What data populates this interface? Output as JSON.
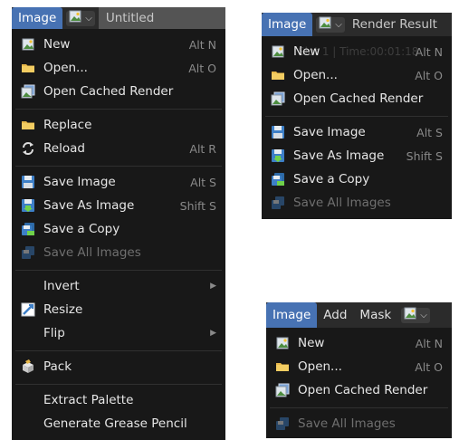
{
  "panel1": {
    "header": {
      "tab": "Image",
      "title": "Untitled"
    },
    "items": [
      {
        "label": "New",
        "shortcut": "Alt N",
        "icon": "image-new-icon"
      },
      {
        "label": "Open...",
        "shortcut": "Alt O",
        "icon": "folder-icon"
      },
      {
        "label": "Open Cached Render",
        "shortcut": "",
        "icon": "cached-render-icon"
      },
      {
        "label": "Replace",
        "shortcut": "",
        "icon": "folder-icon"
      },
      {
        "label": "Reload",
        "shortcut": "Alt R",
        "icon": "reload-icon"
      },
      {
        "label": "Save Image",
        "shortcut": "Alt S",
        "icon": "save-icon"
      },
      {
        "label": "Save As Image",
        "shortcut": "Shift S",
        "icon": "save-as-icon"
      },
      {
        "label": "Save a Copy",
        "shortcut": "",
        "icon": "save-copy-icon"
      },
      {
        "label": "Save All Images",
        "shortcut": "",
        "icon": "save-all-icon"
      },
      {
        "label": "Invert",
        "shortcut": "",
        "icon": ""
      },
      {
        "label": "Resize",
        "shortcut": "",
        "icon": "resize-icon"
      },
      {
        "label": "Flip",
        "shortcut": "",
        "icon": ""
      },
      {
        "label": "Pack",
        "shortcut": "",
        "icon": "pack-icon"
      },
      {
        "label": "Extract Palette",
        "shortcut": "",
        "icon": ""
      },
      {
        "label": "Generate Grease Pencil",
        "shortcut": "",
        "icon": ""
      }
    ]
  },
  "panel2": {
    "header": {
      "tab": "Image",
      "title": "Render Result"
    },
    "ghost_text": "Slot 1 | Time:00:01:18",
    "items": [
      {
        "label": "New",
        "shortcut": "Alt N",
        "icon": "image-new-icon"
      },
      {
        "label": "Open...",
        "shortcut": "Alt O",
        "icon": "folder-icon"
      },
      {
        "label": "Open Cached Render",
        "shortcut": "",
        "icon": "cached-render-icon"
      },
      {
        "label": "Save Image",
        "shortcut": "Alt S",
        "icon": "save-icon"
      },
      {
        "label": "Save As Image",
        "shortcut": "Shift S",
        "icon": "save-as-icon"
      },
      {
        "label": "Save a Copy",
        "shortcut": "",
        "icon": "save-copy-icon"
      },
      {
        "label": "Save All Images",
        "shortcut": "",
        "icon": "save-all-icon"
      }
    ]
  },
  "panel3": {
    "header": {
      "tabs": [
        "Image",
        "Add",
        "Mask"
      ]
    },
    "items": [
      {
        "label": "New",
        "shortcut": "Alt N",
        "icon": "image-new-icon"
      },
      {
        "label": "Open...",
        "shortcut": "Alt O",
        "icon": "folder-icon"
      },
      {
        "label": "Open Cached Render",
        "shortcut": "",
        "icon": "cached-render-icon"
      },
      {
        "label": "Save All Images",
        "shortcut": "",
        "icon": "save-all-icon"
      }
    ]
  },
  "colors": {
    "menu_bg": "#181818",
    "header_bg": "#2b2b2b",
    "active_tab": "#4772b3",
    "text": "#e6e6e6",
    "shortcut_text": "#8a8a8a",
    "disabled_text": "#6f6f6f",
    "separator": "#303030"
  }
}
